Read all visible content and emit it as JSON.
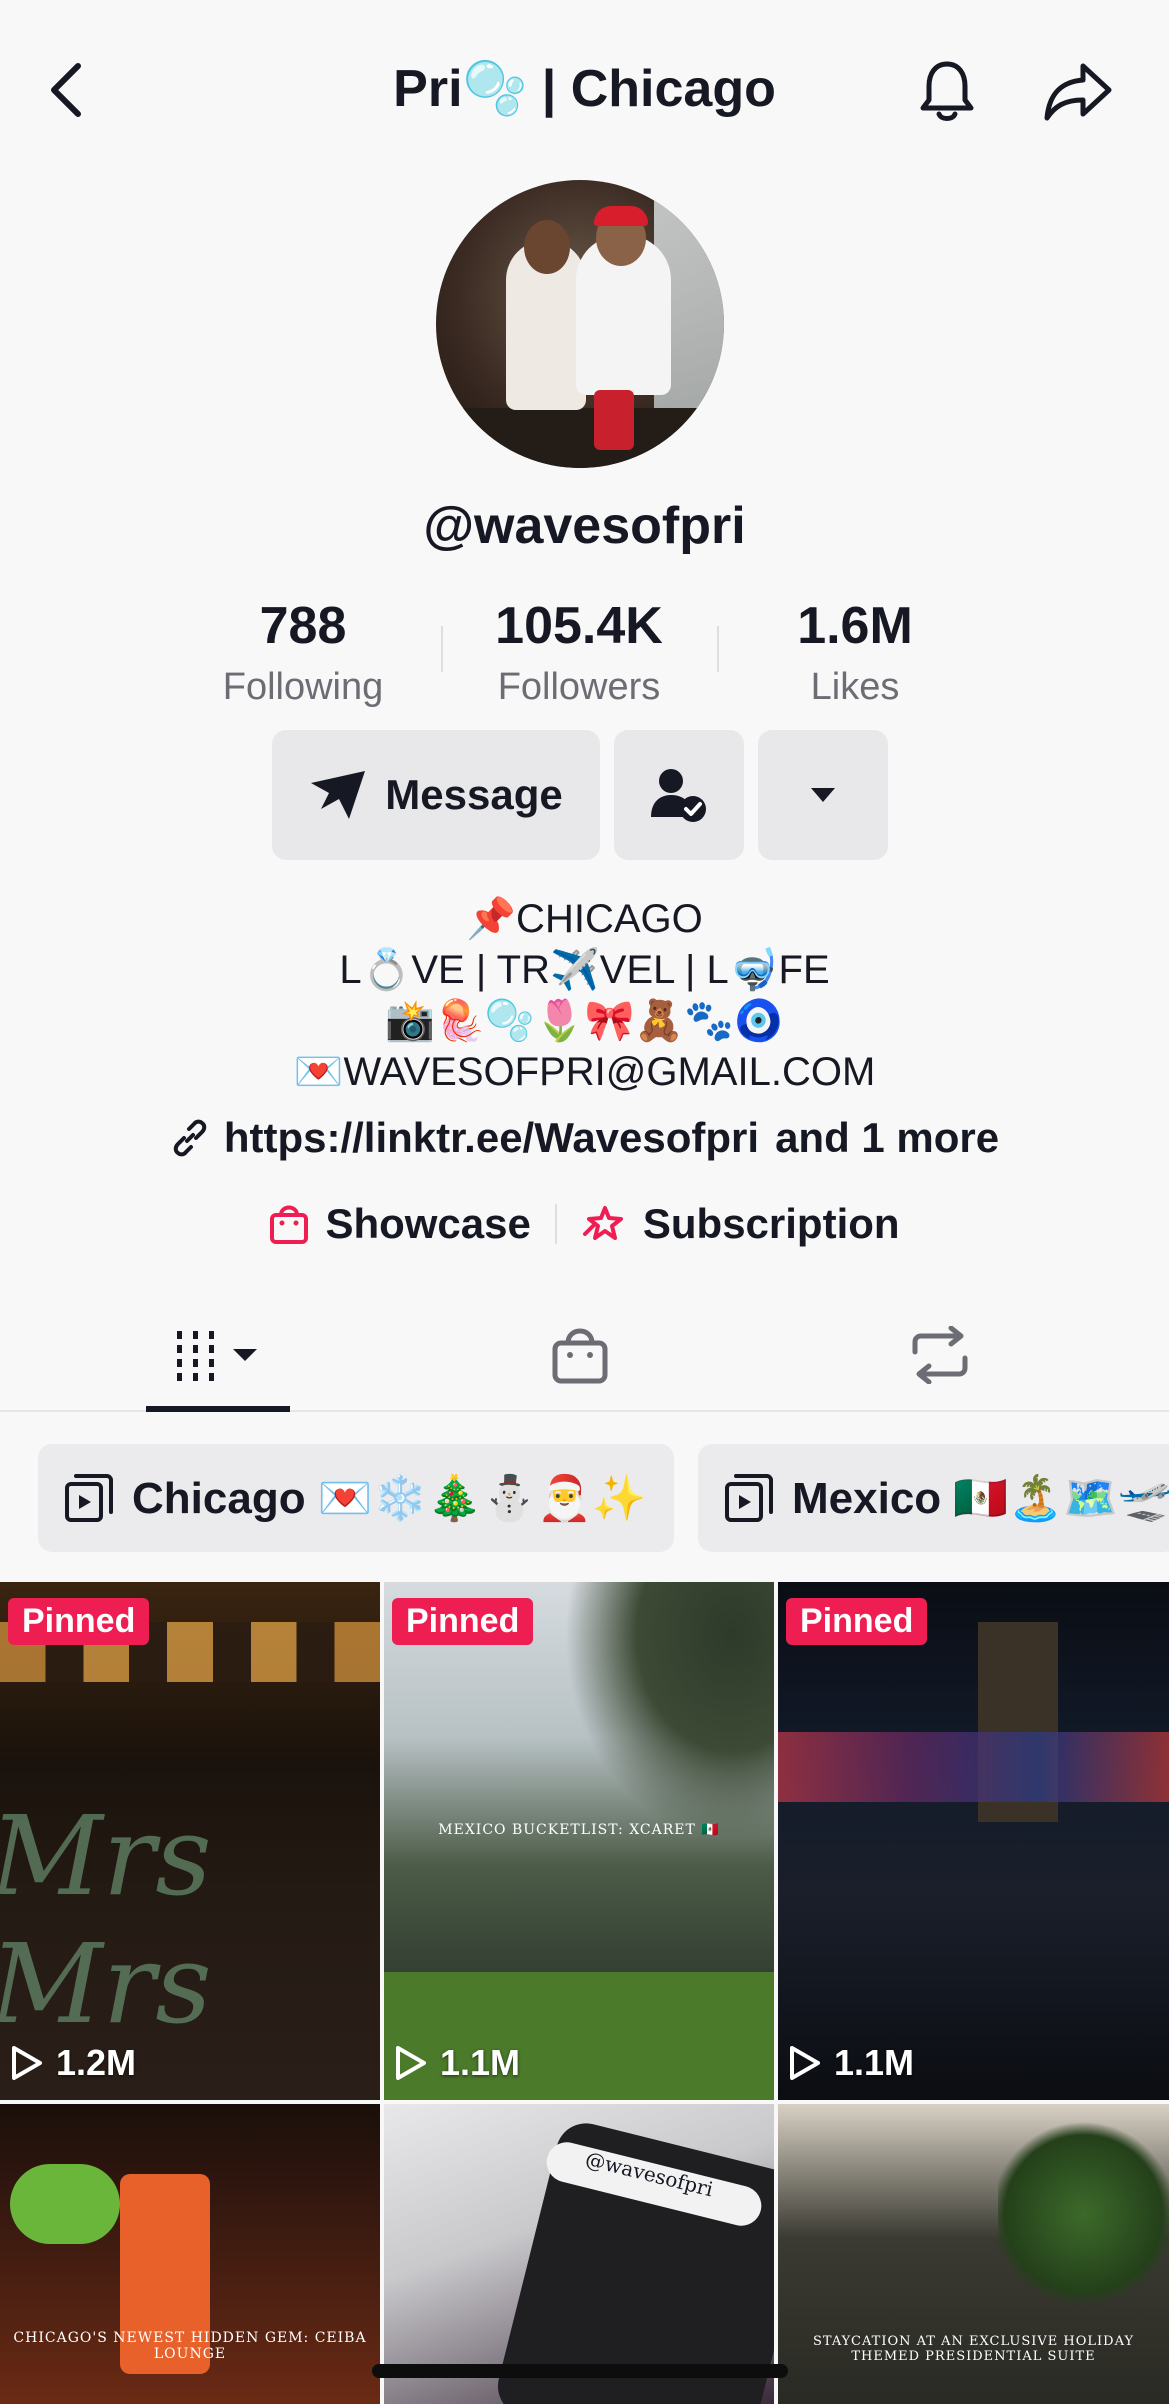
{
  "header": {
    "title": "Pri🫧 | Chicago",
    "back_icon": "chevron-left-icon",
    "bell_icon": "bell-icon",
    "share_icon": "share-arrow-icon"
  },
  "profile": {
    "username": "@wavesofpri",
    "stats": [
      {
        "value": "788",
        "label": "Following"
      },
      {
        "value": "105.4K",
        "label": "Followers"
      },
      {
        "value": "1.6M",
        "label": "Likes"
      }
    ],
    "message_label": "Message",
    "bio": [
      "📌CHICAGO",
      "L💍VE | TR✈️VEL | L🤿FE",
      "📸🪼🫧🌷🎀🧸🐾🧿",
      "💌WAVESOFPRI@GMAIL.COM"
    ],
    "link_text": "https://linktr.ee/Wavesofpri",
    "link_more": "and 1 more",
    "showcase_label": "Showcase",
    "subscription_label": "Subscription"
  },
  "playlists": [
    {
      "label": "Chicago 💌❄️🎄⛄🎅✨"
    },
    {
      "label": "Mexico 🇲🇽🏝️🗺️🛫"
    }
  ],
  "videos": [
    {
      "pinned": "Pinned",
      "views": "1.2M",
      "overlay": "Mrs Mrs"
    },
    {
      "pinned": "Pinned",
      "views": "1.1M",
      "overlay": "MEXICO BUCKETLIST: XCARET 🇲🇽"
    },
    {
      "pinned": "Pinned",
      "views": "1.1M",
      "overlay": ""
    },
    {
      "views": "",
      "overlay": "CHICAGO'S NEWEST HIDDEN GEM: CEIBA LOUNGE"
    },
    {
      "views": "",
      "overlay": "@wavesofpri"
    },
    {
      "views": "",
      "overlay": "STAYCATION AT AN EXCLUSIVE HOLIDAY THEMED PRESIDENTIAL SUITE"
    }
  ],
  "colors": {
    "background": "#f8f8f8",
    "text": "#161823",
    "muted": "#6c6d74",
    "pinned": "#ee1d52",
    "accent_pink": "#ee1d52"
  }
}
